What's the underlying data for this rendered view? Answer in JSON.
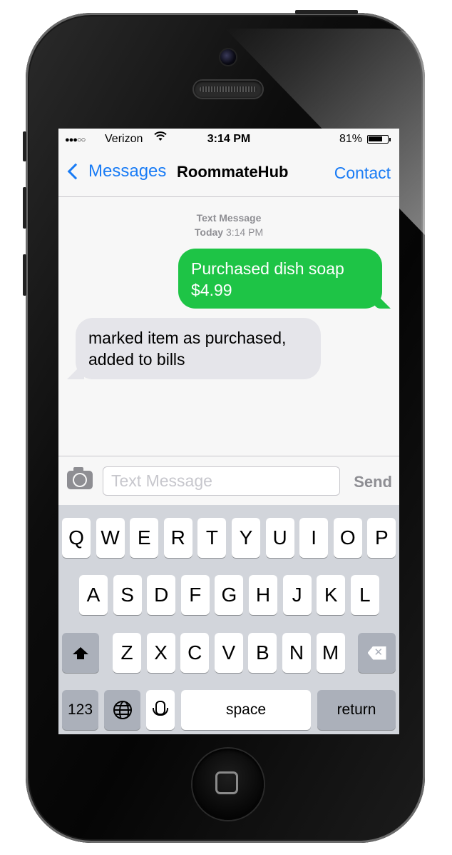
{
  "status_bar": {
    "signal": "●●●○○",
    "carrier": "Verizon",
    "wifi_icon": "wifi-icon",
    "time": "3:14 PM",
    "battery_percent": "81%",
    "battery_level": 0.81
  },
  "nav": {
    "back_label": "Messages",
    "title": "RoommateHub",
    "contact_label": "Contact"
  },
  "thread": {
    "header_line1": "Text Message",
    "header_day": "Today",
    "header_time": "3:14 PM",
    "messages": [
      {
        "direction": "outgoing",
        "lines": [
          "Purchased dish soap",
          "$4.99"
        ]
      },
      {
        "direction": "incoming",
        "lines": [
          "marked item as purchased,",
          "added to bills"
        ]
      }
    ]
  },
  "composer": {
    "camera_icon": "camera-icon",
    "placeholder": "Text Message",
    "value": "",
    "send_label": "Send"
  },
  "keyboard": {
    "row1": [
      "Q",
      "W",
      "E",
      "R",
      "T",
      "Y",
      "U",
      "I",
      "O",
      "P"
    ],
    "row2": [
      "A",
      "S",
      "D",
      "F",
      "G",
      "H",
      "J",
      "K",
      "L"
    ],
    "row3": [
      "Z",
      "X",
      "C",
      "V",
      "B",
      "N",
      "M"
    ],
    "numbers_label": "123",
    "space_label": "space",
    "return_label": "return",
    "shift_icon": "shift-icon",
    "delete_icon": "delete-icon",
    "globe_icon": "globe-icon",
    "mic_icon": "microphone-icon"
  },
  "colors": {
    "accent": "#1a7cf5",
    "outgoing_bubble": "#1ec446",
    "incoming_bubble": "#e5e5ea"
  }
}
